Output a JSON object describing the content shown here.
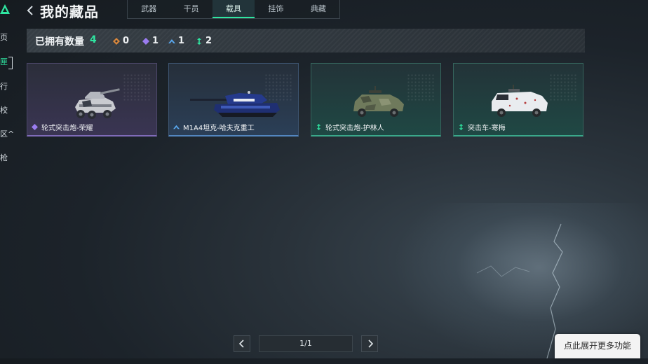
{
  "colors": {
    "accent": "#2fe6a1",
    "rarity_gold": "#d9873c",
    "rarity_purple": "#9a7cf0",
    "rarity_blue": "#5aa9f0",
    "rarity_green": "#2fe6a1"
  },
  "left_nav": {
    "items": [
      {
        "label": "页",
        "active": false
      },
      {
        "label": "匣",
        "active": true
      },
      {
        "label": "行",
        "active": false
      },
      {
        "label": "校",
        "active": false
      },
      {
        "label": "区^",
        "active": false
      },
      {
        "label": "枪",
        "active": false
      }
    ]
  },
  "header": {
    "title": "我的藏品",
    "tabs": [
      {
        "label": "武器",
        "active": false
      },
      {
        "label": "干员",
        "active": false
      },
      {
        "label": "载具",
        "active": true
      },
      {
        "label": "挂饰",
        "active": false
      },
      {
        "label": "典藏",
        "active": false
      }
    ]
  },
  "summary": {
    "label": "已拥有数量",
    "total": "4",
    "stats": [
      {
        "icon": "gold-diamond-icon",
        "value": "0"
      },
      {
        "icon": "purple-diamond-icon",
        "value": "1"
      },
      {
        "icon": "blue-chevron-icon",
        "value": "1"
      },
      {
        "icon": "green-arrows-icon",
        "value": "2"
      }
    ]
  },
  "cards": [
    {
      "name": "轮式突击炮-荣耀",
      "rarity": "purple",
      "icon": "purple-diamond-icon"
    },
    {
      "name": "M1A4坦克-哈夫克重工",
      "rarity": "blue",
      "icon": "blue-chevron-icon"
    },
    {
      "name": "轮式突击炮-护林人",
      "rarity": "green",
      "icon": "green-arrows-icon"
    },
    {
      "name": "突击车-寒梅",
      "rarity": "green",
      "icon": "green-arrows-icon"
    }
  ],
  "pagination": {
    "indicator": "1/1"
  },
  "expand_button": {
    "label": "点此展开更多功能"
  }
}
